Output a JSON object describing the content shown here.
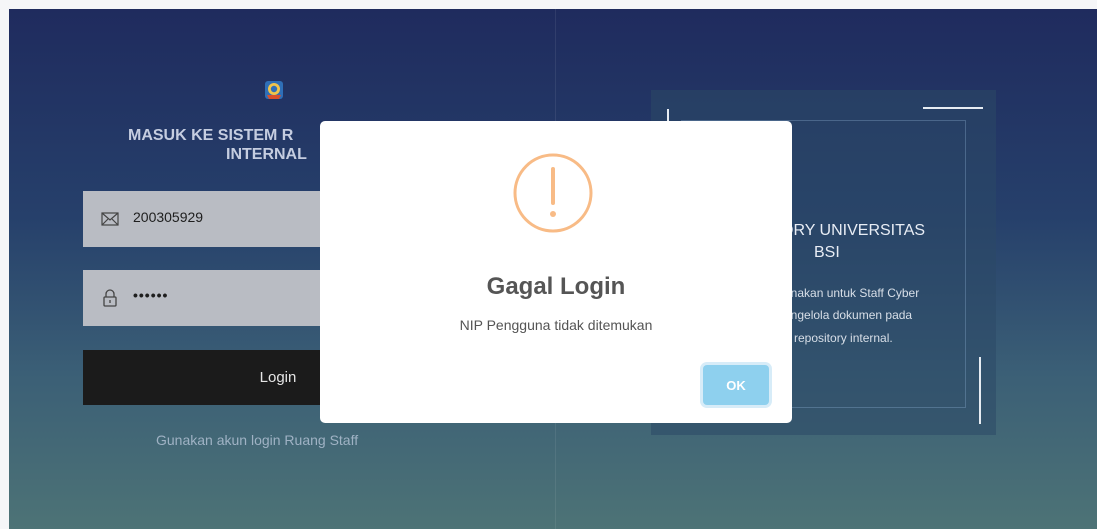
{
  "login": {
    "title_line1": "MASUK KE SISTEM R",
    "title_line2": "INTERNAL",
    "email_value": "200305929",
    "password_mask": "••••••",
    "login_label": "Login",
    "hint": "Gunakan akun login Ruang Staff"
  },
  "info_card": {
    "title_line1": "ORY UNIVERSITAS",
    "title_line2": "BSI",
    "desc_line1": "unakan untuk Staff Cyber",
    "desc_line2": "engelola dokumen pada",
    "desc_line3": "repository internal."
  },
  "dialog": {
    "title": "Gagal Login",
    "message": "NIP Pengguna tidak ditemukan",
    "ok_label": "OK",
    "icon": "warning-icon",
    "icon_color": "#f8bb86",
    "ok_color": "#8ed0ee"
  },
  "icons": {
    "logo": "university-logo",
    "email": "envelope-icon",
    "password": "lock-icon"
  }
}
